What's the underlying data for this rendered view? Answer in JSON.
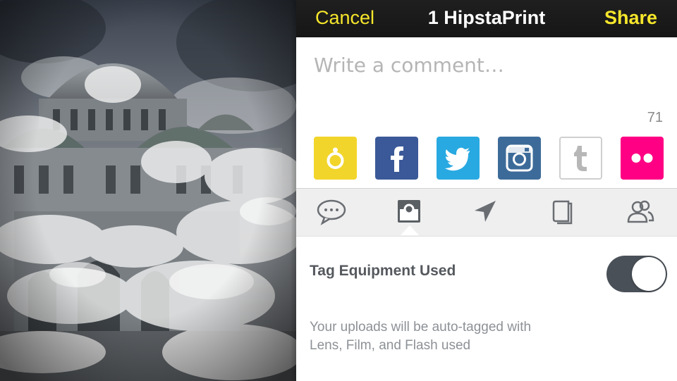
{
  "nav": {
    "cancel_label": "Cancel",
    "title": "1 HipstaPrint",
    "share_label": "Share",
    "accent_color": "#f5e62b"
  },
  "compose": {
    "placeholder": "Write a comment…",
    "char_counter": "71"
  },
  "share_services": [
    {
      "name": "hipstamatic",
      "icon": "hipstamatic-icon",
      "color": "#f2d52a"
    },
    {
      "name": "facebook",
      "icon": "facebook-icon",
      "color": "#3b5998"
    },
    {
      "name": "twitter",
      "icon": "twitter-icon",
      "color": "#29a9e1"
    },
    {
      "name": "instagram",
      "icon": "instagram-icon",
      "color": "#3d6b99"
    },
    {
      "name": "tumblr",
      "icon": "tumblr-icon",
      "color": "#ffffff"
    },
    {
      "name": "flickr",
      "icon": "flickr-icon",
      "color": "#ff0084"
    }
  ],
  "tabs": [
    {
      "icon": "comment-bubble-icon",
      "selected": false
    },
    {
      "icon": "camera-equipment-icon",
      "selected": true
    },
    {
      "icon": "location-arrow-icon",
      "selected": false
    },
    {
      "icon": "book-icon",
      "selected": false
    },
    {
      "icon": "people-icon",
      "selected": false
    }
  ],
  "setting": {
    "label": "Tag Equipment Used",
    "enabled": true,
    "description": "Your uploads will be auto-tagged with\nLens, Film, and Flash used"
  },
  "photo": {
    "subject": "cathedral-in-clouds-photo"
  }
}
